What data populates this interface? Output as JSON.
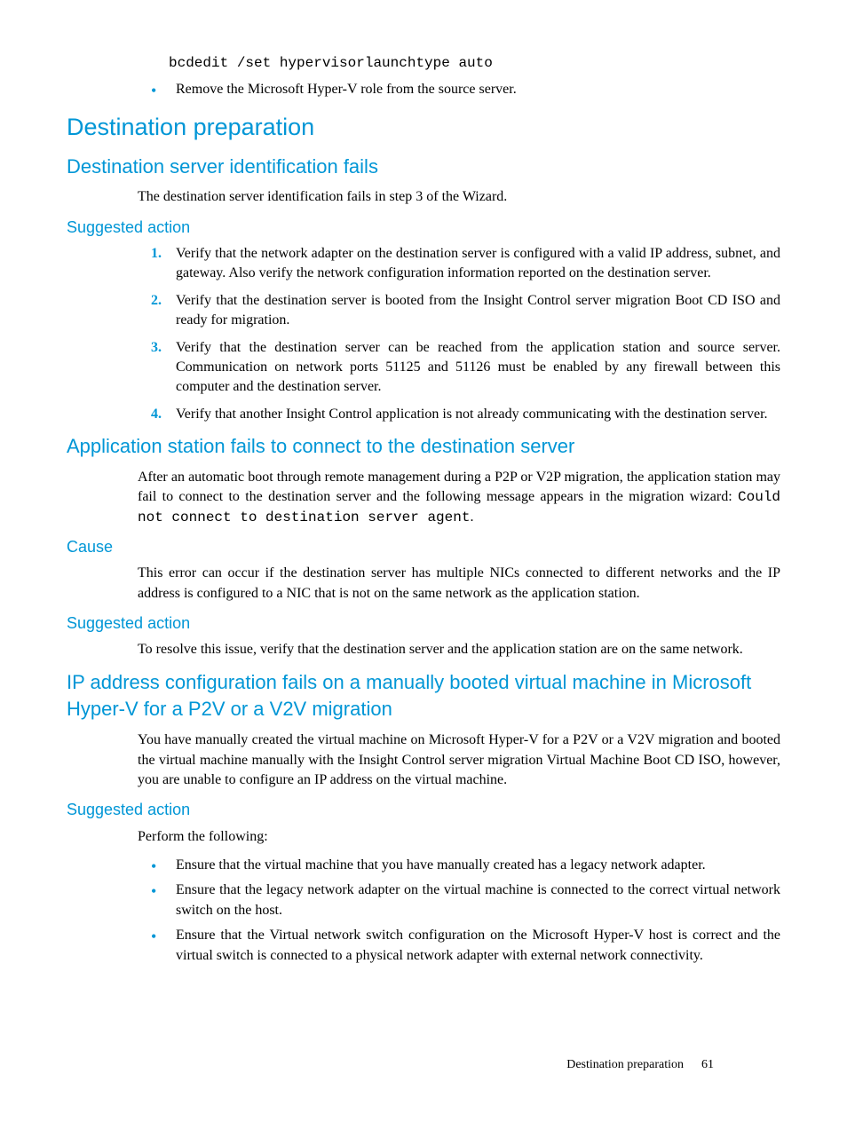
{
  "top": {
    "code": "bcdedit /set hypervisorlaunchtype auto",
    "bullet1": "Remove the Microsoft Hyper-V role from the source server."
  },
  "sec1": {
    "h2": "Destination preparation",
    "h3a": "Destination server identification fails",
    "p1": "The destination server identification fails in step 3 of the Wizard.",
    "h4a": "Suggested action",
    "ol": [
      "Verify that the network adapter on the destination server is configured with a valid IP address, subnet, and gateway. Also verify the network configuration information reported on the destination server.",
      "Verify that the destination server is booted from the Insight Control server migration Boot CD ISO and ready for migration.",
      "Verify that the destination server can be reached from the application station and source server. Communication on network ports 51125 and 51126 must be enabled by any firewall between this computer and the destination server.",
      "Verify that another Insight Control application is not already communicating with the destination server."
    ]
  },
  "sec2": {
    "h3": "Application station fails to connect to the destination server",
    "p1a": "After an automatic boot through remote management during a P2P or V2P migration, the application station may fail to connect to the destination server and the following message appears in the migration wizard: ",
    "p1code": "Could not connect to destination server agent",
    "p1b": ".",
    "h4a": "Cause",
    "p2": "This error can occur if the destination server has multiple NICs connected to different networks and the IP address is configured to a NIC that is not on the same network as the application station.",
    "h4b": "Suggested action",
    "p3": "To resolve this issue, verify that the destination server and the application station are on the same network."
  },
  "sec3": {
    "h3": "IP address configuration fails on a manually booted virtual machine in Microsoft Hyper-V for a P2V or a V2V migration",
    "p1": "You have manually created the virtual machine on Microsoft Hyper-V for a P2V or a V2V migration and booted the virtual machine manually with the Insight Control server migration Virtual Machine Boot CD ISO, however, you are unable to configure an IP address on the virtual machine.",
    "h4": "Suggested action",
    "p2": "Perform the following:",
    "ul": [
      "Ensure that the virtual machine that you have manually created has a legacy network adapter.",
      "Ensure that the legacy network adapter on the virtual machine is connected to the correct virtual network switch on the host.",
      "Ensure that the Virtual network switch configuration on the Microsoft Hyper-V host is correct and the virtual switch is connected to a physical network adapter with external network connectivity."
    ]
  },
  "footer": {
    "label": "Destination preparation",
    "page": "61"
  }
}
